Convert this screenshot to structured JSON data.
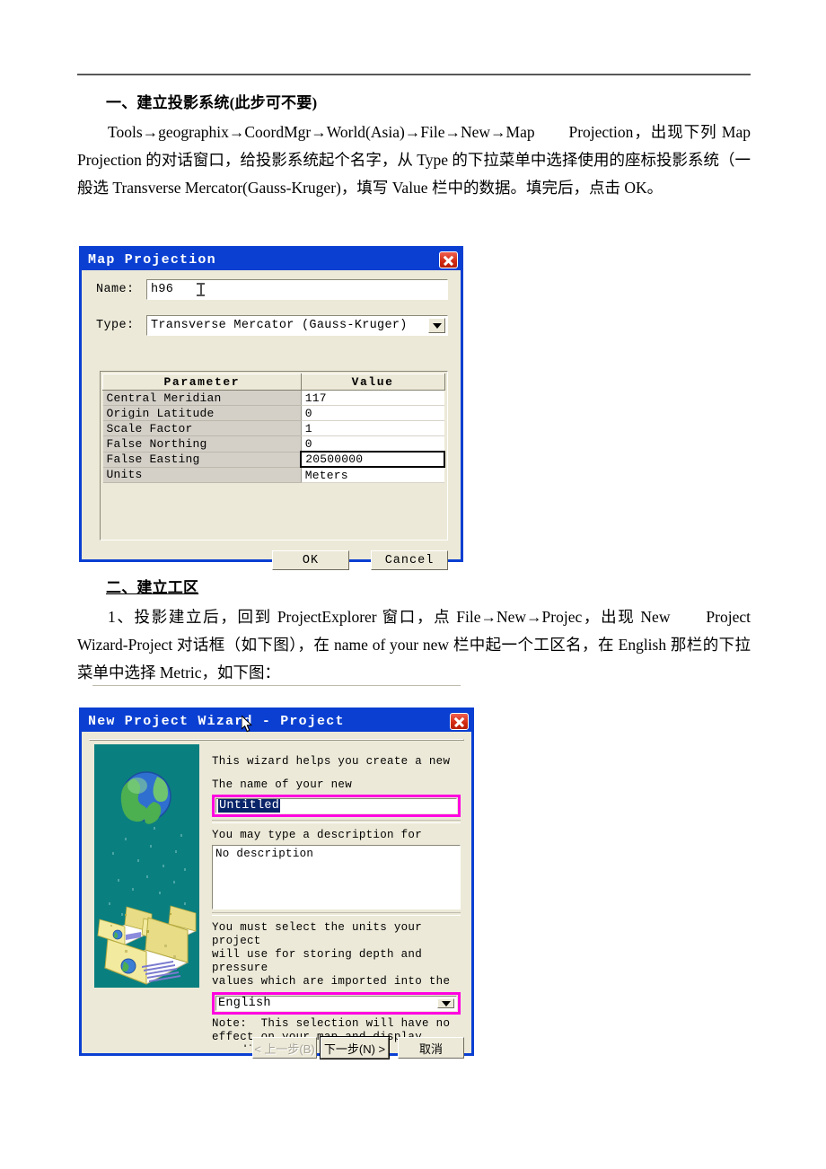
{
  "document": {
    "section1_heading": "一、建立投影系统(此步可不要)",
    "section1_para": "Tools→geographix→CoordMgr→World(Asia)→File→New→Map　　Projection，出现下列 Map Projection 的对话窗口，给投影系统起个名字，从 Type 的下拉菜单中选择使用的座标投影系统（一般选 Transverse Mercator(Gauss-Kruger)，填写 Value 栏中的数据。填完后，点击 OK。",
    "section2_heading": "二、建立工区",
    "section2_para": "1、投影建立后，回到 ProjectExplorer 窗口，点 File→New→Projec，出现 New　　Project Wizard-Project 对话框（如下图），在 name of your new 栏中起一个工区名，在 English 那栏的下拉菜单中选择 Metric，如下图："
  },
  "map_projection_dialog": {
    "title": "Map Projection",
    "close_icon": "close-icon",
    "name_label": "Name:",
    "name_value": "h96",
    "type_label": "Type:",
    "type_value": "Transverse Mercator (Gauss-Kruger)",
    "table": {
      "headers": [
        "Parameter",
        "Value"
      ],
      "rows": [
        {
          "parameter": "Central Meridian",
          "value": "117",
          "selected": false
        },
        {
          "parameter": "Origin Latitude",
          "value": "0",
          "selected": false
        },
        {
          "parameter": "Scale Factor",
          "value": "1",
          "selected": false
        },
        {
          "parameter": "False Northing",
          "value": "0",
          "selected": false
        },
        {
          "parameter": "False Easting",
          "value": "20500000",
          "selected": true
        },
        {
          "parameter": "Units",
          "value": "Meters",
          "selected": false
        }
      ]
    },
    "ok_label": "OK",
    "cancel_label": "Cancel",
    "colors": {
      "titlebar": "#0a3fd2",
      "face": "#ece9d8",
      "close_button": "#d22a12"
    }
  },
  "new_project_wizard_dialog": {
    "title": "New Project Wizard - Project",
    "close_icon": "close-icon",
    "intro_text": "This wizard helps you create a new",
    "name_prompt": "The name of your new",
    "name_value": "Untitled",
    "description_prompt": "You may type a description for",
    "description_value": "No description",
    "units_prompt": "You must select the units your project\nwill use for storing depth and pressure\nvalues which are imported into the",
    "units_value": "English",
    "note_text": "Note:  This selection will have no\neffect on your map and display\ncoordinate system selection",
    "back_label": "< 上一步(B)",
    "next_label": "下一步(N) >",
    "cancel_label": "取消",
    "colors": {
      "titlebar": "#0a3fd2",
      "artwork_bg": "#0a7f7f",
      "highlight_outline": "#ff00e0",
      "selection_bg": "#0a246a"
    }
  }
}
